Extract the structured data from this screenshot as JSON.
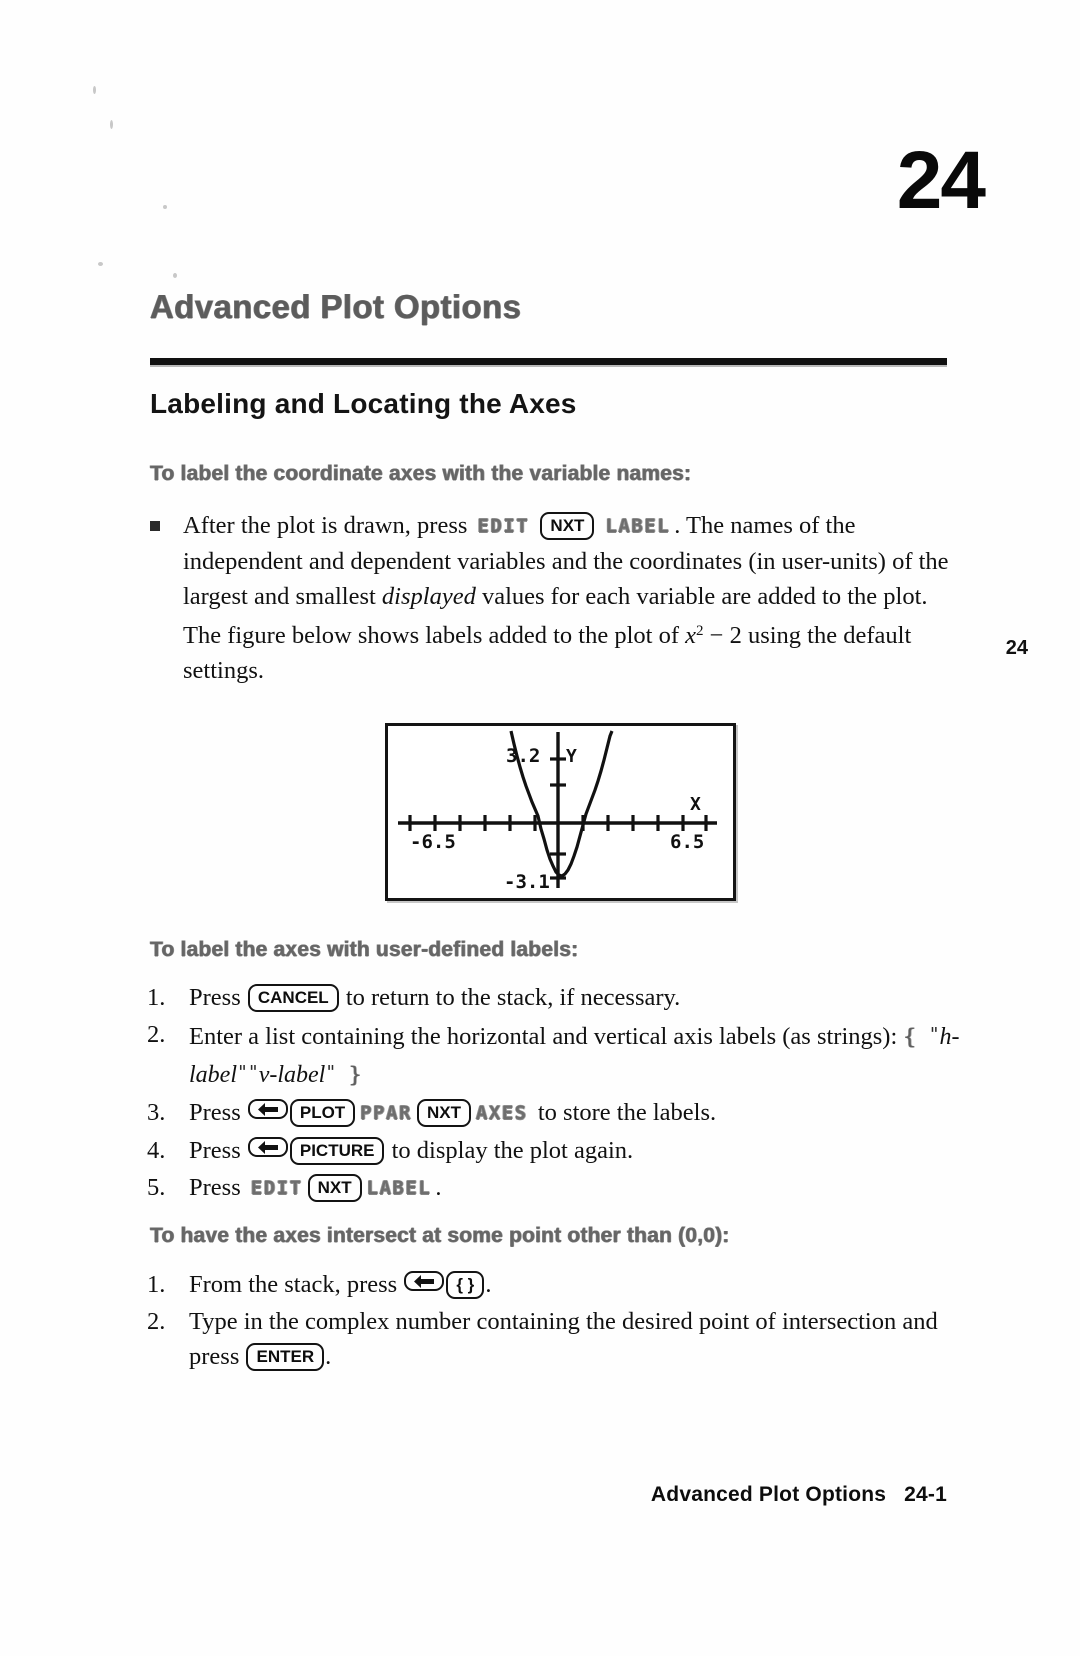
{
  "page": {
    "chapter_number": "24",
    "chapter_title": "Advanced Plot Options",
    "margin_tab": "24",
    "footer_title": "Advanced Plot Options",
    "footer_page": "24-1"
  },
  "section": {
    "heading": "Labeling and Locating the Axes"
  },
  "subheads": {
    "variable_names": "To label the coordinate axes with the variable names:",
    "user_defined": "To label the axes with user-defined labels:",
    "intersect": "To have the axes intersect at some point other than (0,0):"
  },
  "bullet": {
    "text_before_keys": "After the plot is drawn, press",
    "key_edit": "EDIT",
    "key_nxt": "NXT",
    "key_label": "LABEL",
    "text_after_keys": ". The names of the independent and dependent variables and the coordinates (in user-units) of the largest and smallest",
    "italic_word": "displayed",
    "text_tail_1": "values for each variable are added to the plot. The figure below shows labels added to the plot of",
    "math_x": "x",
    "math_exp": "2",
    "math_rest": "− 2",
    "text_tail_2": "using the default settings."
  },
  "figure": {
    "y_max_label": "3.2",
    "y_min_label": "-3.1",
    "x_min_label": "-6.5",
    "x_max_label": "6.5",
    "y_axis_name": "Y",
    "x_axis_name": "X",
    "function": "x^2 - 2"
  },
  "list_user_defined": [
    {
      "num": "1.",
      "parts": [
        {
          "kind": "text",
          "value": "Press "
        },
        {
          "kind": "key",
          "value": "CANCEL"
        },
        {
          "kind": "text",
          "value": " to return to the stack, if necessary."
        }
      ]
    },
    {
      "num": "2.",
      "parts": [
        {
          "kind": "text",
          "value": "Enter a list containing the horizontal and vertical axis labels (as strings): "
        },
        {
          "kind": "listsym",
          "value": "{"
        },
        {
          "kind": "quote",
          "value": "\""
        },
        {
          "kind": "italic",
          "value": "h-label"
        },
        {
          "kind": "quote",
          "value": "\""
        },
        {
          "kind": "quote",
          "value": "\""
        },
        {
          "kind": "italic",
          "value": "v-label"
        },
        {
          "kind": "quote",
          "value": "\""
        },
        {
          "kind": "listsym",
          "value": "}"
        }
      ]
    },
    {
      "num": "3.",
      "parts": [
        {
          "kind": "text",
          "value": "Press "
        },
        {
          "kind": "arrowkey",
          "value": "left-shift-arrow"
        },
        {
          "kind": "key",
          "value": "PLOT"
        },
        {
          "kind": "softkey",
          "value": "PPAR"
        },
        {
          "kind": "key",
          "value": "NXT"
        },
        {
          "kind": "softkey",
          "value": "AXES"
        },
        {
          "kind": "text",
          "value": " to store the labels."
        }
      ]
    },
    {
      "num": "4.",
      "parts": [
        {
          "kind": "text",
          "value": "Press "
        },
        {
          "kind": "arrowkey",
          "value": "left-shift-arrow"
        },
        {
          "kind": "key",
          "value": "PICTURE"
        },
        {
          "kind": "text",
          "value": " to display the plot again."
        }
      ]
    },
    {
      "num": "5.",
      "parts": [
        {
          "kind": "text",
          "value": "Press "
        },
        {
          "kind": "softkey",
          "value": "EDIT"
        },
        {
          "kind": "key",
          "value": "NXT"
        },
        {
          "kind": "softkey",
          "value": "LABEL"
        },
        {
          "kind": "text",
          "value": "."
        }
      ]
    }
  ],
  "list_intersect": [
    {
      "num": "1.",
      "parts": [
        {
          "kind": "text",
          "value": "From the stack, press "
        },
        {
          "kind": "arrowkey",
          "value": "left-shift-arrow"
        },
        {
          "kind": "key",
          "value": "{ }"
        },
        {
          "kind": "text",
          "value": "."
        }
      ]
    },
    {
      "num": "2.",
      "parts": [
        {
          "kind": "text",
          "value": "Type in the complex number containing the desired point of intersection and press "
        },
        {
          "kind": "key",
          "value": "ENTER"
        },
        {
          "kind": "text",
          "value": "."
        }
      ]
    }
  ]
}
